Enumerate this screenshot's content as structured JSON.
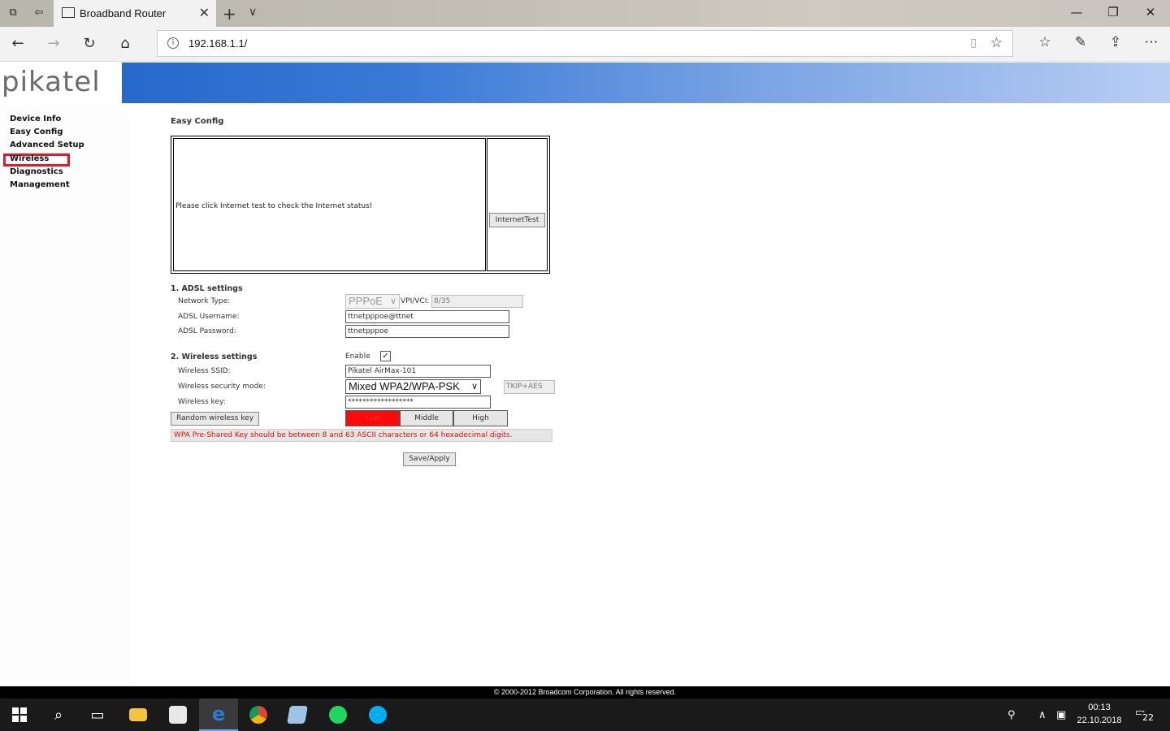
{
  "browser": {
    "tab_title": "Broadband Router",
    "url": "192.168.1.1/"
  },
  "router": {
    "brand": "pikatel",
    "menu": [
      "Device Info",
      "Easy Config",
      "Advanced Setup",
      "Wireless",
      "Diagnostics",
      "Management"
    ],
    "selected_menu": "Wireless",
    "page_title": "Easy Config",
    "status_message": "Please click Internet test to check the Internet status!",
    "internet_test_button": "InternetTest",
    "adsl": {
      "section_title": "1. ADSL settings",
      "network_type_label": "Network Type:",
      "network_type_value": "PPPoE",
      "vpi_vci_label": "VPI/VCI:",
      "vpi_vci_value": "8/35",
      "username_label": "ADSL Username:",
      "username_value": "ttnetpppoe@ttnet",
      "password_label": "ADSL Password:",
      "password_value": "ttnetpppoe"
    },
    "wireless": {
      "section_title": "2. Wireless settings",
      "enable_label": "Enable",
      "enable_checked": true,
      "ssid_label": "Wireless SSID:",
      "ssid_value": "Pikatel AirMax-101",
      "security_label": "Wireless security mode:",
      "security_value": "Mixed WPA2/WPA-PSK",
      "encryption_value": "TKIP+AES",
      "key_label": "Wireless key:",
      "key_value": "******************",
      "random_key_button": "Random wireless key",
      "strength_low": "Low",
      "strength_middle": "Middle",
      "strength_high": "High",
      "warning": "WPA Pre-Shared Key should be between 8 and 63 ASCII characters or 64 hexadecimal digits."
    },
    "save_button": "Save/Apply",
    "footer": "© 2000-2012 Broadcom Corporation. All rights reserved."
  },
  "taskbar": {
    "time": "00:13",
    "date": "22.10.2018",
    "notification_count": "22"
  },
  "colors": {
    "banner_start": "#1e62c6",
    "banner_end": "#b9cef4",
    "menu_highlight": "#e01b2b",
    "strength_low": "#fb0a0a",
    "warning_text": "#e01010"
  },
  "icons": [
    "tab-group-icon",
    "back-tab-icon",
    "page-icon",
    "close-icon",
    "new-tab-icon",
    "chevron-down-icon",
    "minimize-icon",
    "restore-icon",
    "back-icon",
    "forward-icon",
    "refresh-icon",
    "home-icon",
    "info-icon",
    "reading-view-icon",
    "star-icon",
    "favorites-icon",
    "pen-icon",
    "share-icon",
    "more-icon",
    "windows-start-icon",
    "search-icon",
    "task-view-icon",
    "file-explorer-icon",
    "store-icon",
    "edge-icon",
    "chrome-icon",
    "notepad-icon",
    "spotify-icon",
    "skype-icon",
    "people-icon",
    "chevron-up-icon",
    "network-icon",
    "notification-icon"
  ]
}
